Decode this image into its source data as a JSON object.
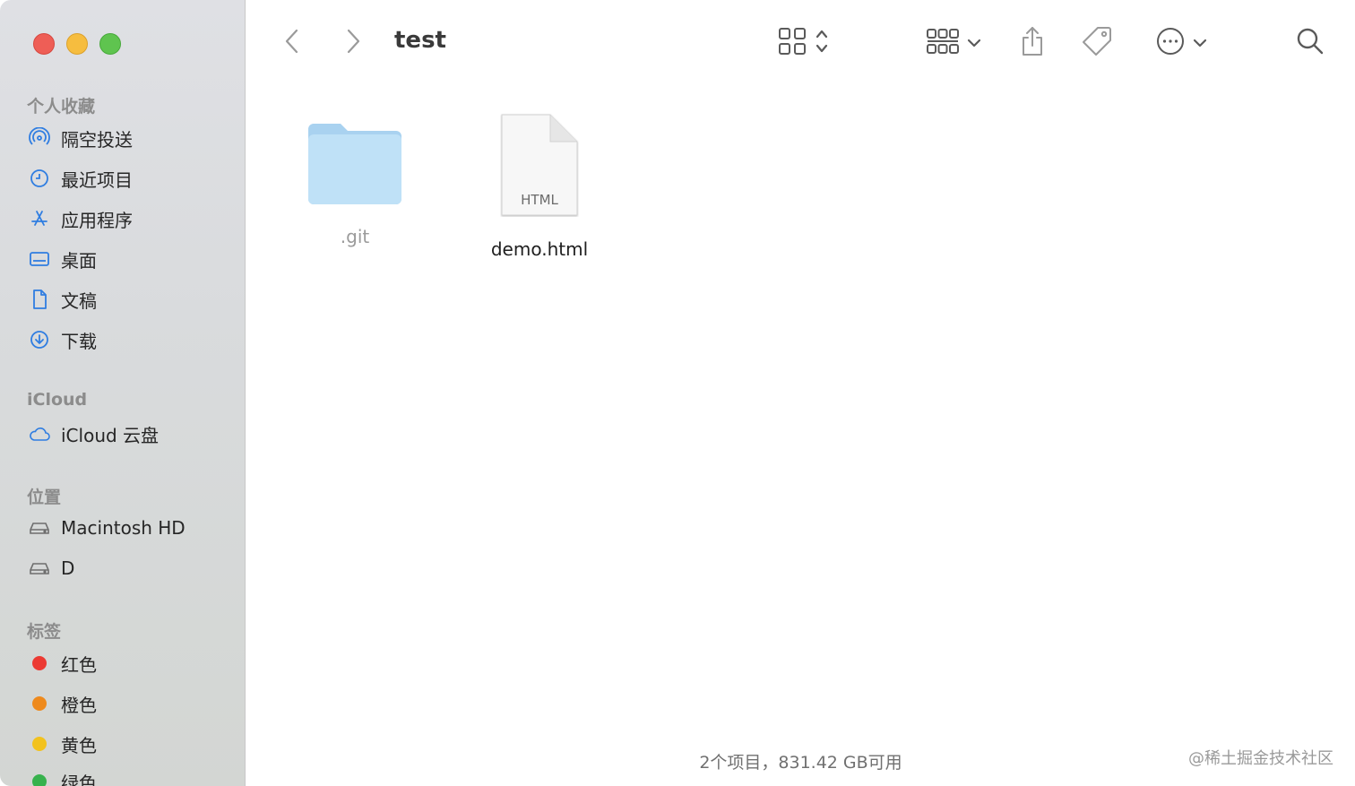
{
  "window": {
    "title": "test"
  },
  "sidebar": {
    "favorites_title": "个人收藏",
    "favorites": [
      {
        "label": "隔空投送",
        "icon": "airdrop-icon"
      },
      {
        "label": "最近项目",
        "icon": "clock-icon"
      },
      {
        "label": "应用程序",
        "icon": "applications-icon"
      },
      {
        "label": "桌面",
        "icon": "desktop-icon"
      },
      {
        "label": "文稿",
        "icon": "document-icon"
      },
      {
        "label": "下载",
        "icon": "download-icon"
      }
    ],
    "icloud_title": "iCloud",
    "icloud": [
      {
        "label": "iCloud 云盘",
        "icon": "cloud-icon"
      }
    ],
    "locations_title": "位置",
    "locations": [
      {
        "label": "Macintosh HD",
        "icon": "drive-icon"
      },
      {
        "label": "D",
        "icon": "drive-icon"
      }
    ],
    "tags_title": "标签",
    "tags": [
      {
        "label": "红色",
        "color": "#ec3a33"
      },
      {
        "label": "橙色",
        "color": "#ee8a1d"
      },
      {
        "label": "黄色",
        "color": "#f2c21e"
      },
      {
        "label": "绿色",
        "color": "#37b24d"
      }
    ]
  },
  "files": [
    {
      "name": ".git",
      "kind": "folder",
      "hidden": true
    },
    {
      "name": "demo.html",
      "kind": "file",
      "badge": "HTML"
    }
  ],
  "status": "2个项目，831.42 GB可用",
  "watermark": "@稀土掘金技术社区",
  "colors": {
    "accent": "#2f7de1",
    "folder": "#bfe1f7"
  }
}
